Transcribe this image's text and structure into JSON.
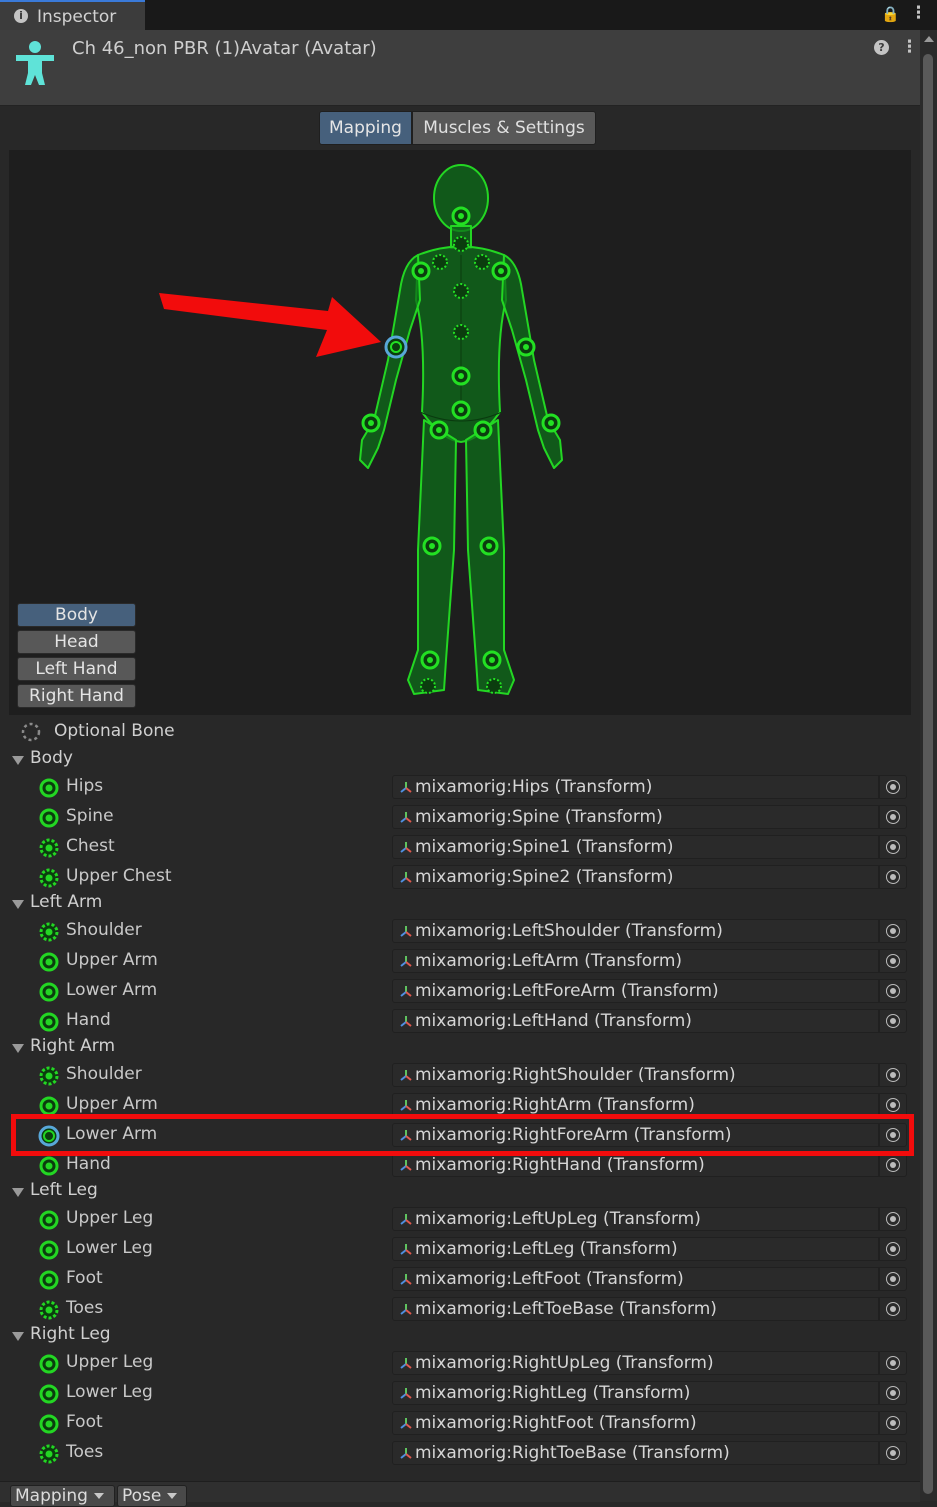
{
  "tab": {
    "title": "Inspector"
  },
  "header": {
    "title": "Ch 46_non PBR (1)Avatar (Avatar)"
  },
  "segments": {
    "mapping": "Mapping",
    "muscles": "Muscles & Settings"
  },
  "parts": {
    "body": "Body",
    "head": "Head",
    "left_hand": "Left Hand",
    "right_hand": "Right Hand"
  },
  "optional_bone": "Optional Bone",
  "groups": {
    "body": {
      "label": "Body",
      "rows": [
        {
          "name": "Hips",
          "value": "mixamorig:Hips (Transform)",
          "optional": false
        },
        {
          "name": "Spine",
          "value": "mixamorig:Spine (Transform)",
          "optional": false
        },
        {
          "name": "Chest",
          "value": "mixamorig:Spine1 (Transform)",
          "optional": true
        },
        {
          "name": "Upper Chest",
          "value": "mixamorig:Spine2 (Transform)",
          "optional": true
        }
      ]
    },
    "left_arm": {
      "label": "Left Arm",
      "rows": [
        {
          "name": "Shoulder",
          "value": "mixamorig:LeftShoulder (Transform)",
          "optional": true
        },
        {
          "name": "Upper Arm",
          "value": "mixamorig:LeftArm (Transform)",
          "optional": false
        },
        {
          "name": "Lower Arm",
          "value": "mixamorig:LeftForeArm (Transform)",
          "optional": false
        },
        {
          "name": "Hand",
          "value": "mixamorig:LeftHand (Transform)",
          "optional": false
        }
      ]
    },
    "right_arm": {
      "label": "Right Arm",
      "rows": [
        {
          "name": "Shoulder",
          "value": "mixamorig:RightShoulder (Transform)",
          "optional": true
        },
        {
          "name": "Upper Arm",
          "value": "mixamorig:RightArm (Transform)",
          "optional": false
        },
        {
          "name": "Lower Arm",
          "value": "mixamorig:RightForeArm (Transform)",
          "optional": false,
          "selected": true
        },
        {
          "name": "Hand",
          "value": "mixamorig:RightHand (Transform)",
          "optional": false
        }
      ]
    },
    "left_leg": {
      "label": "Left Leg",
      "rows": [
        {
          "name": "Upper Leg",
          "value": "mixamorig:LeftUpLeg (Transform)",
          "optional": false
        },
        {
          "name": "Lower Leg",
          "value": "mixamorig:LeftLeg (Transform)",
          "optional": false
        },
        {
          "name": "Foot",
          "value": "mixamorig:LeftFoot (Transform)",
          "optional": false
        },
        {
          "name": "Toes",
          "value": "mixamorig:LeftToeBase (Transform)",
          "optional": true
        }
      ]
    },
    "right_leg": {
      "label": "Right Leg",
      "rows": [
        {
          "name": "Upper Leg",
          "value": "mixamorig:RightUpLeg (Transform)",
          "optional": false
        },
        {
          "name": "Lower Leg",
          "value": "mixamorig:RightLeg (Transform)",
          "optional": false
        },
        {
          "name": "Foot",
          "value": "mixamorig:RightFoot (Transform)",
          "optional": false
        },
        {
          "name": "Toes",
          "value": "mixamorig:RightToeBase (Transform)",
          "optional": true
        }
      ]
    }
  },
  "footer": {
    "mapping": "Mapping",
    "pose": "Pose"
  },
  "colors": {
    "bone_green": "#1ed01e",
    "selected_ring": "#58a7d8",
    "annotation_red": "#f20c0c",
    "accent_blue": "#46607c"
  }
}
